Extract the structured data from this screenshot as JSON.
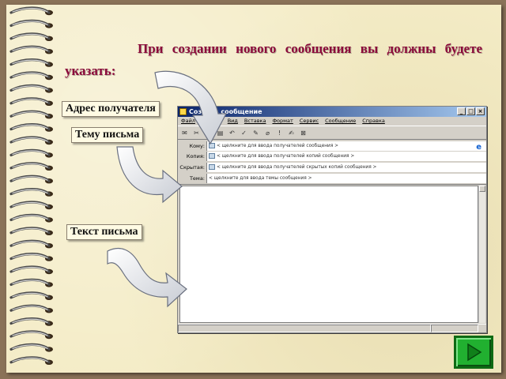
{
  "slide": {
    "title": "При создании нового сообщения вы должны будете указать:"
  },
  "labels": {
    "recipient": "Адрес получателя",
    "subject": "Тему письма",
    "body": "Текст письма"
  },
  "window": {
    "title": "Создать сообщение",
    "menu": [
      "Файл",
      "Правка",
      "Вид",
      "Вставка",
      "Формат",
      "Сервис",
      "Сообщение",
      "Справка"
    ],
    "fields": [
      {
        "label": "Кому:",
        "placeholder": "< щелкните для ввода получателей сообщения >"
      },
      {
        "label": "Копия:",
        "placeholder": "< щелкните для ввода получателей копий сообщения >"
      },
      {
        "label": "Скрытая:",
        "placeholder": "< щелкните для ввода получателей скрытых копий сообщения >"
      },
      {
        "label": "Тема:",
        "placeholder": "< щелкните для ввода темы сообщения >"
      }
    ]
  },
  "colors": {
    "title": "#8b0a3a",
    "next_button": "#21b030",
    "titlebar": "#0a246a"
  },
  "icons": {
    "next": "play-triangle-icon",
    "spiral": "spiral-binding-icon"
  }
}
